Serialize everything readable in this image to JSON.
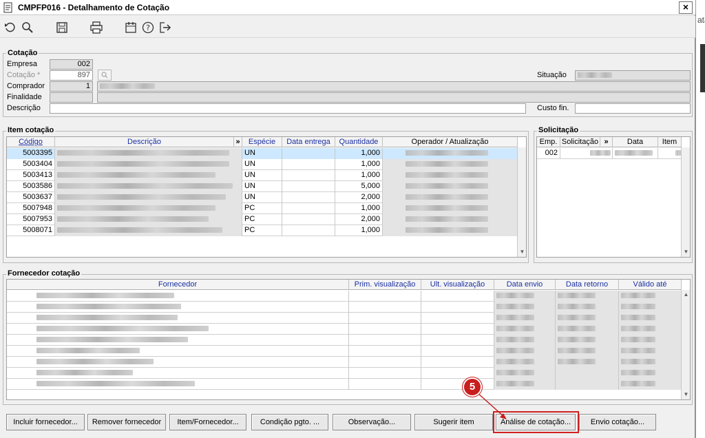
{
  "window": {
    "title": "CMPFP016 - Detalhamento de Cotação",
    "close_label": "×"
  },
  "toolbar": {
    "icons": [
      "undo-icon",
      "search-icon",
      "save-icon",
      "print-icon",
      "calendar-icon",
      "help-icon",
      "exit-icon"
    ]
  },
  "cotacao": {
    "group_label": "Cotação",
    "empresa_label": "Empresa",
    "empresa_value": "002",
    "cotacao_label": "Cotação *",
    "cotacao_value": "897",
    "comprador_label": "Comprador",
    "comprador_value": "1",
    "finalidade_label": "Finalidade",
    "descricao_label": "Descrição",
    "situacao_label": "Situação",
    "custo_label": "Custo fin."
  },
  "item_cotacao": {
    "group_label": "Item cotação",
    "columns": [
      "Código",
      "Descrição",
      "»",
      "Espécie",
      "Data entrega",
      "Quantidade",
      "Operador / Atualização"
    ],
    "rows": [
      {
        "codigo": "5003395",
        "especie": "UN",
        "quantidade": "1,000"
      },
      {
        "codigo": "5003404",
        "especie": "UN",
        "quantidade": "1,000"
      },
      {
        "codigo": "5003413",
        "especie": "UN",
        "quantidade": "1,000"
      },
      {
        "codigo": "5003586",
        "especie": "UN",
        "quantidade": "5,000"
      },
      {
        "codigo": "5003637",
        "especie": "UN",
        "quantidade": "2,000"
      },
      {
        "codigo": "5007948",
        "especie": "PC",
        "quantidade": "1,000"
      },
      {
        "codigo": "5007953",
        "especie": "PC",
        "quantidade": "2,000"
      },
      {
        "codigo": "5008071",
        "especie": "PC",
        "quantidade": "1,000"
      }
    ]
  },
  "solicitacao": {
    "group_label": "Solicitação",
    "columns": [
      "Emp.",
      "Solicitação",
      "»",
      "Data",
      "Item"
    ],
    "rows": [
      {
        "emp": "002"
      }
    ]
  },
  "fornecedor_cotacao": {
    "group_label": "Fornecedor cotação",
    "columns": [
      "Fornecedor",
      "Prim. visualização",
      "Ult. visualização",
      "Data envio",
      "Data retorno",
      "Válido até"
    ]
  },
  "buttons": {
    "incluir": "Incluir fornecedor...",
    "remover": "Remover fornecedor",
    "item_fornecedor": "Item/Fornecedor...",
    "condicao": "Condição pgto. ...",
    "observacao": "Observação...",
    "sugerir": "Sugerir item",
    "analise": "Análise de cotação...",
    "envio": "Envio cotação..."
  },
  "annotation": {
    "step": "5",
    "color": "#c81e1e"
  },
  "background": {
    "peek_text": "ata"
  }
}
